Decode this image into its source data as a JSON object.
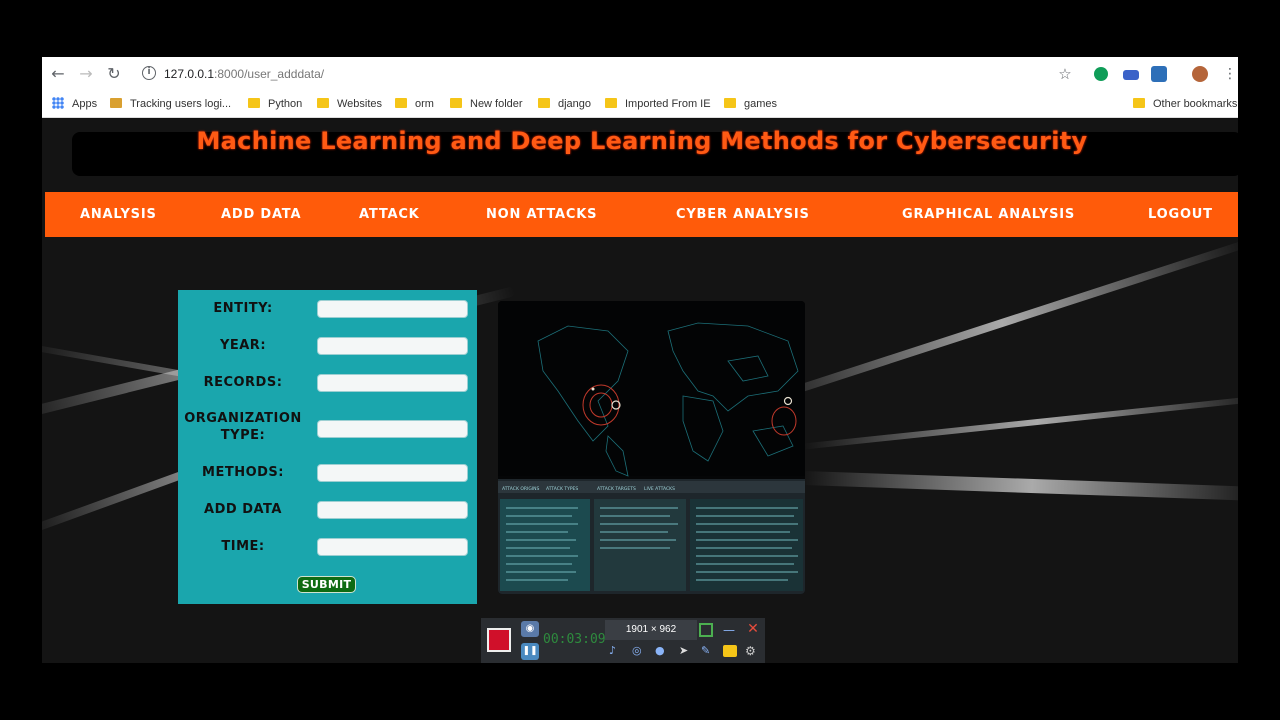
{
  "browser": {
    "url_host": "127.0.0.1",
    "url_rest": ":8000/user_adddata/",
    "bookmarks": [
      {
        "label": "Apps"
      },
      {
        "label": "Tracking users logi..."
      },
      {
        "label": "Python"
      },
      {
        "label": "Websites"
      },
      {
        "label": "orm"
      },
      {
        "label": "New folder"
      },
      {
        "label": "django"
      },
      {
        "label": "Imported From IE"
      },
      {
        "label": "games"
      }
    ],
    "other_bookmarks": "Other bookmarks"
  },
  "site": {
    "title": "Machine Learning and Deep Learning Methods for Cybersecurity"
  },
  "nav": {
    "items": [
      {
        "label": "ANALYSIS"
      },
      {
        "label": "ADD DATA"
      },
      {
        "label": "ATTACK"
      },
      {
        "label": "NON ATTACKS"
      },
      {
        "label": "CYBER ANALYSIS"
      },
      {
        "label": "GRAPHICAL ANALYSIS"
      },
      {
        "label": "LOGOUT"
      }
    ]
  },
  "form": {
    "fields": [
      {
        "label": "ENTITY:",
        "value": ""
      },
      {
        "label": "YEAR:",
        "value": ""
      },
      {
        "label": "RECORDS:",
        "value": ""
      },
      {
        "label": "ORGANIZATION TYPE:",
        "value": ""
      },
      {
        "label": "METHODS:",
        "value": ""
      },
      {
        "label": "ADD DATA",
        "value": ""
      },
      {
        "label": "TIME:",
        "value": ""
      }
    ],
    "submit_label": "SUBMIT"
  },
  "map_panel": {
    "tabs": [
      "ATTACK ORIGINS",
      "ATTACK TYPES",
      "ATTACK TARGETS",
      "LIVE ATTACKS"
    ]
  },
  "recorder": {
    "timer": "00:03:09",
    "resolution": "1901 × 962"
  },
  "colors": {
    "accent": "#ff5b0a",
    "title": "#ff5a14",
    "form_bg": "#1aa6ad",
    "submit_bg": "#0e6b12"
  }
}
